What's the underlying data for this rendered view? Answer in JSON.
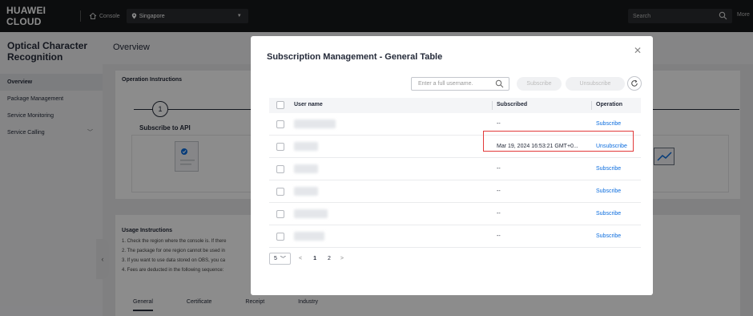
{
  "topbar": {
    "logo": "HUAWEI CLOUD",
    "console": "Console",
    "region": "Singapore",
    "search": "Search",
    "more": "More"
  },
  "sidebar": {
    "service_title": "Optical Character Recognition",
    "items": [
      {
        "label": "Overview",
        "active": true
      },
      {
        "label": "Package Management"
      },
      {
        "label": "Service Monitoring"
      },
      {
        "label": "Service Calling"
      }
    ]
  },
  "main": {
    "page_title": "Overview",
    "operation_instructions": "Operation Instructions",
    "step_number": "1",
    "step_title": "Subscribe to API",
    "usage_title": "Usage Instructions",
    "usage_lines": [
      "1. Check the region where the console is. If there",
      "2. The package for one region cannot be used in",
      "3. If you want to use data stored on OBS, you ca",
      "4. Fees are deducted in the following sequence:"
    ],
    "tabs": [
      "General",
      "Certificate",
      "Receipt",
      "Industry"
    ]
  },
  "modal": {
    "title": "Subscription Management - General Table",
    "search_placeholder": "Enter a full username.",
    "subscribe_btn": "Subscribe",
    "unsubscribe_btn": "Unsubscribe",
    "columns": {
      "user": "User name",
      "subscribed": "Subscribed",
      "operation": "Operation"
    },
    "rows": [
      {
        "subscribed": "--",
        "operation": "Subscribe"
      },
      {
        "subscribed": "Mar 19, 2024 16:53:21 GMT+0...",
        "operation": "Unsubscribe"
      },
      {
        "subscribed": "--",
        "operation": "Subscribe"
      },
      {
        "subscribed": "--",
        "operation": "Subscribe"
      },
      {
        "subscribed": "--",
        "operation": "Subscribe"
      },
      {
        "subscribed": "--",
        "operation": "Subscribe"
      }
    ],
    "pager": {
      "size": "5",
      "current": "1",
      "next_page": "2"
    }
  }
}
